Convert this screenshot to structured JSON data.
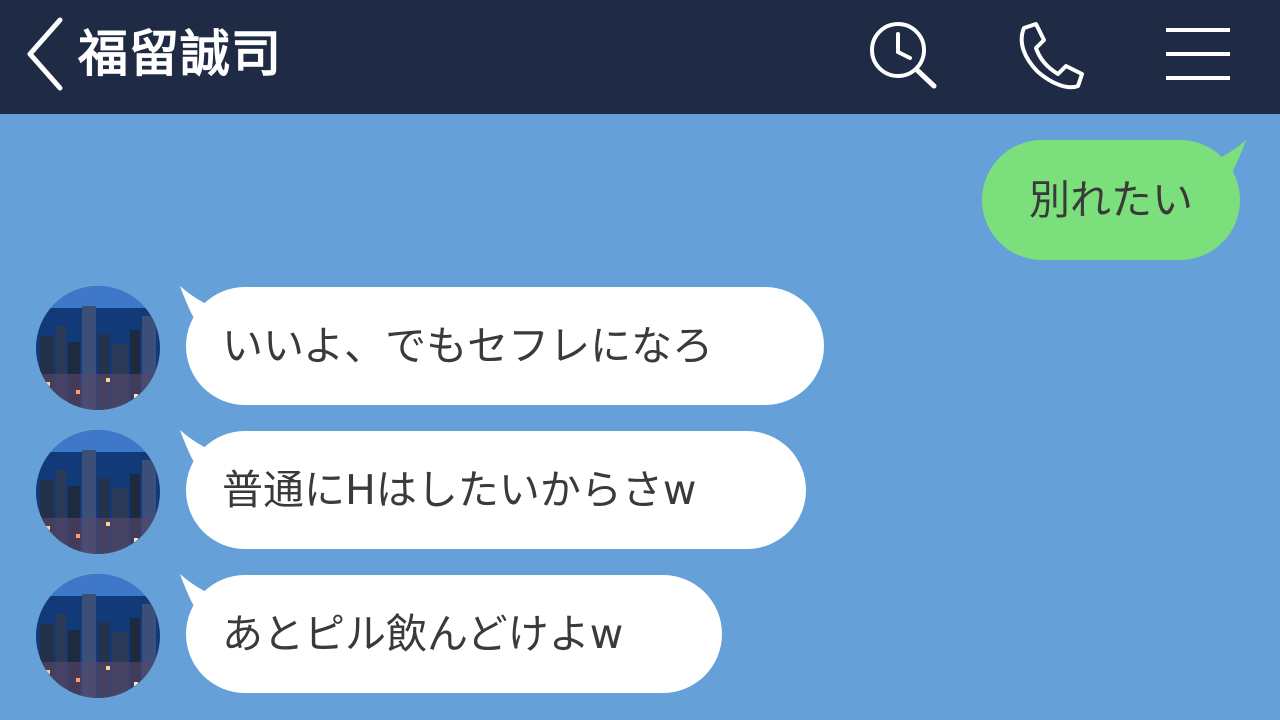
{
  "header": {
    "title": "福留誠司",
    "back_icon": "chevron-left-icon",
    "search_icon": "search-clock-icon",
    "phone_icon": "phone-icon",
    "menu_icon": "hamburger-menu-icon",
    "background_color": "#1f2a44"
  },
  "chat": {
    "background_color": "#66a0d8",
    "messages": [
      {
        "sender": "me",
        "text": "別れたい"
      },
      {
        "sender": "contact",
        "text": "いいよ、でもセフレになろ"
      },
      {
        "sender": "contact",
        "text": "普通にHはしたいからさw"
      },
      {
        "sender": "contact",
        "text": "あとピル飲んどけよw"
      }
    ]
  },
  "colors": {
    "outgoing_bubble": "#7be07b",
    "incoming_bubble": "#ffffff",
    "text": "#3a3a3a"
  }
}
